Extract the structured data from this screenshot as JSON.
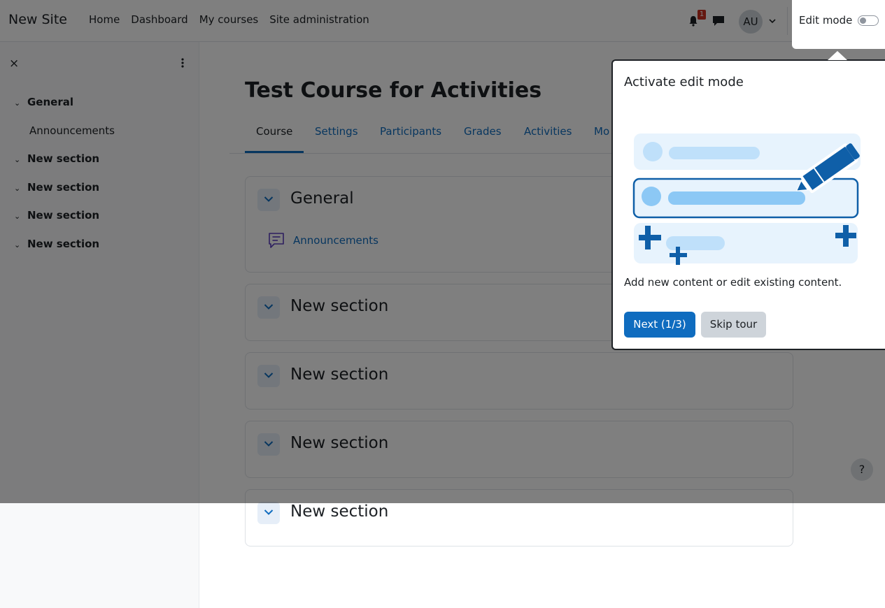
{
  "navbar": {
    "brand": "New Site",
    "links": [
      "Home",
      "Dashboard",
      "My courses",
      "Site administration"
    ],
    "notification_count": "1",
    "avatar_initials": "AU",
    "edit_mode_label": "Edit mode"
  },
  "course_index": {
    "close_icon": "×",
    "items": [
      {
        "label": "General",
        "children": [
          "Announcements"
        ]
      },
      {
        "label": "New section"
      },
      {
        "label": "New section"
      },
      {
        "label": "New section"
      },
      {
        "label": "New section"
      }
    ]
  },
  "main": {
    "title": "Test Course for Activities",
    "tabs": [
      "Course",
      "Settings",
      "Participants",
      "Grades",
      "Activities",
      "Mo"
    ],
    "active_tab": "Course",
    "sections": [
      {
        "title": "General",
        "activities": [
          {
            "name": "Announcements",
            "icon": "forum-icon"
          }
        ]
      },
      {
        "title": "New section"
      },
      {
        "title": "New section"
      },
      {
        "title": "New section"
      },
      {
        "title": "New section"
      }
    ]
  },
  "help_button": "?",
  "tour": {
    "title": "Activate edit mode",
    "content": "Add new content or edit existing content.",
    "next_label": "Next (1/3)",
    "skip_label": "Skip tour"
  },
  "colors": {
    "primary": "#0f6cbf",
    "badge": "#ca3120",
    "backdrop": "rgba(0,0,0,0.5)",
    "illustration_light": "#e7f3fd",
    "illustration_mid": "#bfe0fa",
    "illustration_dark": "#0f5fa8"
  }
}
